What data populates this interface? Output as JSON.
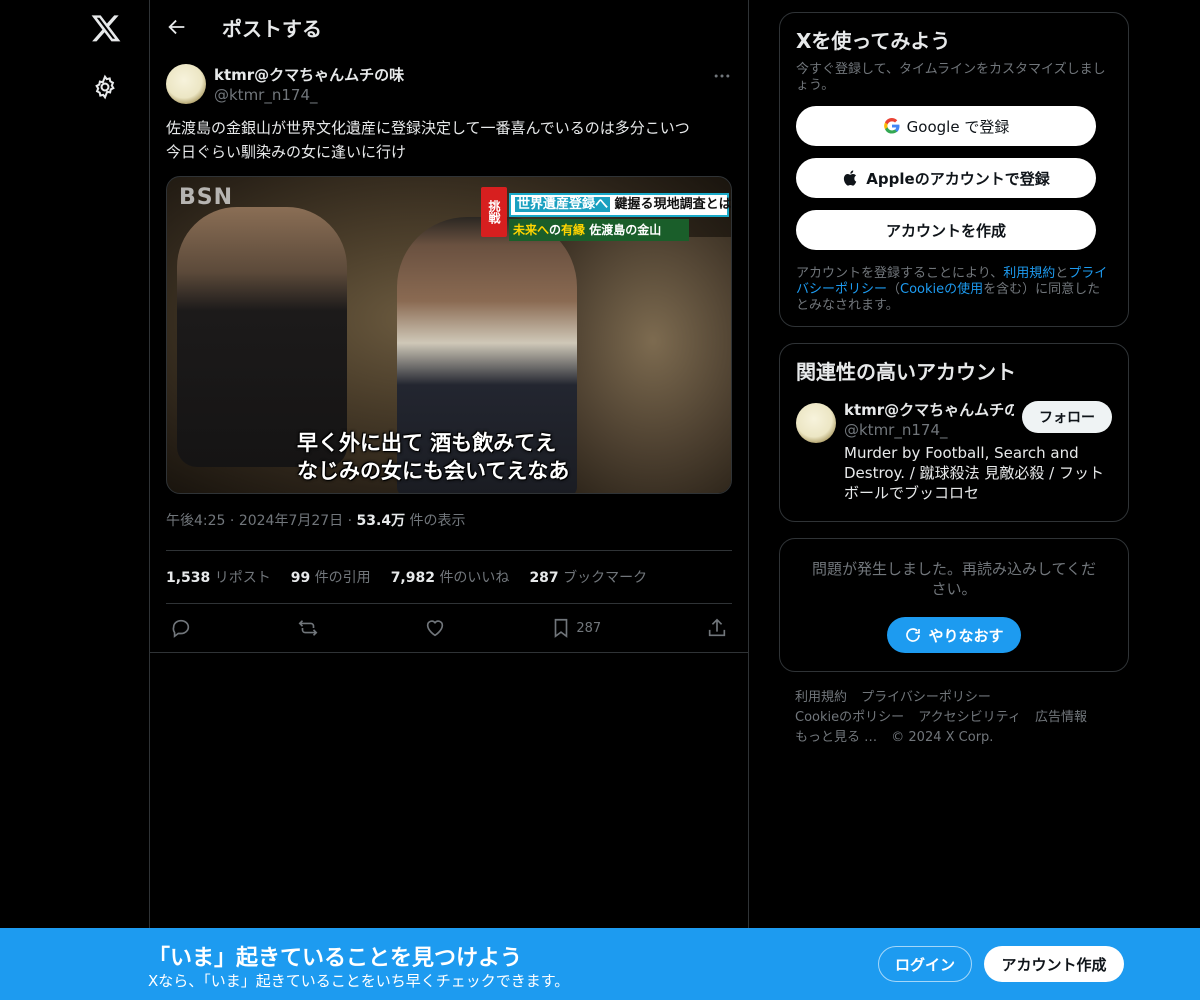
{
  "header": {
    "title": "ポストする"
  },
  "post": {
    "author_name": "ktmr@クマちゃんムチの味",
    "author_handle": "@ktmr_n174_",
    "text": "佐渡島の金銀山が世界文化遺産に登録決定して一番喜んでいるのは多分こいつ\n今日ぐらい馴染みの女に逢いに行け",
    "media": {
      "logo": "BSN",
      "tag": "挑戦",
      "banner_1": "世界遺産登録へ",
      "banner_1b": "鍵握る",
      "banner_1c": "現地調査",
      "banner_1d": "とは",
      "banner_2a": "未来へ",
      "banner_2b": "の",
      "banner_2c": "有縁",
      "banner_2d": "佐渡島の金山",
      "subtitle_1": "早く外に出て 酒も飲みてえ",
      "subtitle_2": "なじみの女にも会いてえなあ"
    },
    "time": "午後4:25",
    "dot": "·",
    "date": "2024年7月27日",
    "views_count": "53.4万",
    "views_label": "件の表示",
    "stats": {
      "reposts": "1,538",
      "reposts_label": "リポスト",
      "quotes": "99",
      "quotes_label": "件の引用",
      "likes": "7,982",
      "likes_label": "件のいいね",
      "bookmarks": "287",
      "bookmarks_label": "ブックマーク"
    },
    "actions": {
      "bookmark_count": "287"
    }
  },
  "signup": {
    "title": "Xを使ってみよう",
    "subtitle": "今すぐ登録して、タイムラインをカスタマイズしましょう。",
    "google_label": "Google で登録",
    "apple_label": "Appleのアカウントで登録",
    "create_label": "アカウントを作成",
    "legal_1": "アカウントを登録することにより、",
    "legal_terms": "利用規約",
    "legal_2": "と",
    "legal_privacy": "プライバシーポリシー",
    "legal_3": "（",
    "legal_cookie": "Cookieの使用",
    "legal_4": "を含む）に同意したとみなされます。"
  },
  "related": {
    "title": "関連性の高いアカウント",
    "name": "ktmr@クマちゃんムチの味",
    "handle": "@ktmr_n174_",
    "bio": "Murder by Football, Search and Destroy. / 蹴球殺法 見敵必殺 / フットボールでブッコロセ",
    "follow_label": "フォロー"
  },
  "error": {
    "message": "問題が発生しました。再読み込みしてください。",
    "retry_label": "やりなおす"
  },
  "footer": {
    "terms": "利用規約",
    "privacy": "プライバシーポリシー",
    "cookie": "Cookieのポリシー",
    "accessibility": "アクセシビリティ",
    "ads": "広告情報",
    "more": "もっと見る …",
    "copyright": "© 2024 X Corp."
  },
  "bottom_bar": {
    "headline": "「いま」起きていることを見つけよう",
    "sub": "Xなら、「いま」起きていることをいち早くチェックできます。",
    "login_label": "ログイン",
    "create_label": "アカウント作成"
  },
  "colors": {
    "accent": "#1d9bf0",
    "background": "#000000",
    "border": "#2f3336",
    "muted": "#71767b"
  }
}
